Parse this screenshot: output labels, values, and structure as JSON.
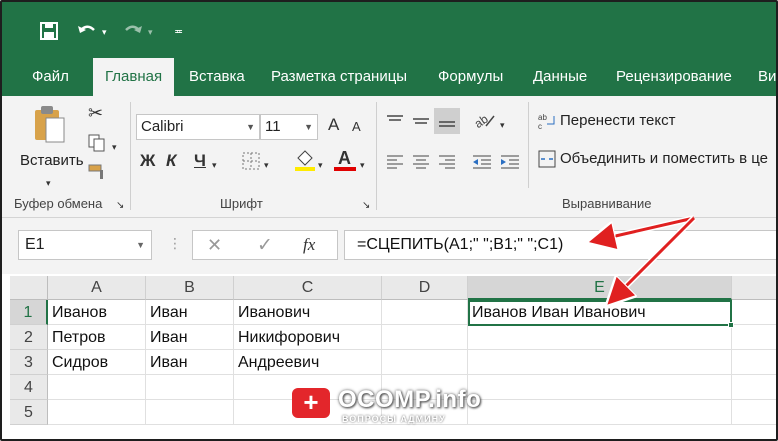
{
  "colors": {
    "brand": "#217346",
    "arrow": "#e02020"
  },
  "qat": {
    "save_icon": "save-icon",
    "undo_icon": "undo-icon",
    "redo_icon": "redo-icon",
    "customize_icon": "customize-qat-icon"
  },
  "tabs": [
    "Файл",
    "Главная",
    "Вставка",
    "Разметка страницы",
    "Формулы",
    "Данные",
    "Рецензирование",
    "Ви"
  ],
  "ribbon": {
    "clipboard": {
      "paste_label": "Вставить",
      "group_label": "Буфер обмена"
    },
    "font": {
      "font_name": "Calibri",
      "font_size": "11",
      "bold": "Ж",
      "italic": "К",
      "underline": "Ч",
      "font_color_glyph": "A",
      "grow": "A",
      "shrink": "A",
      "group_label": "Шрифт"
    },
    "alignment": {
      "wrap_text": "Перенести текст",
      "merge_center": "Объединить и поместить в це",
      "group_label": "Выравнивание"
    }
  },
  "formula_bar": {
    "name_box": "E1",
    "cancel": "✕",
    "enter": "✓",
    "fx": "fx",
    "formula": "=СЦЕПИТЬ(A1;\" \";B1;\" \";C1)"
  },
  "sheet": {
    "columns": [
      "A",
      "B",
      "C",
      "D",
      "E"
    ],
    "rows": [
      "1",
      "2",
      "3",
      "4",
      "5"
    ],
    "cells": [
      [
        "Иванов",
        "Иван",
        "Иванович",
        "",
        "Иванов Иван Иванович"
      ],
      [
        "Петров",
        "Иван",
        "Никифорович",
        "",
        ""
      ],
      [
        "Сидров",
        "Иван",
        "Андреевич",
        "",
        ""
      ],
      [
        "",
        "",
        "",
        "",
        ""
      ],
      [
        "",
        "",
        "",
        "",
        ""
      ]
    ]
  },
  "watermark": {
    "badge": "+",
    "title": "OCOMP.info",
    "subtitle": "ВОПРОСЫ АДМИНУ"
  }
}
